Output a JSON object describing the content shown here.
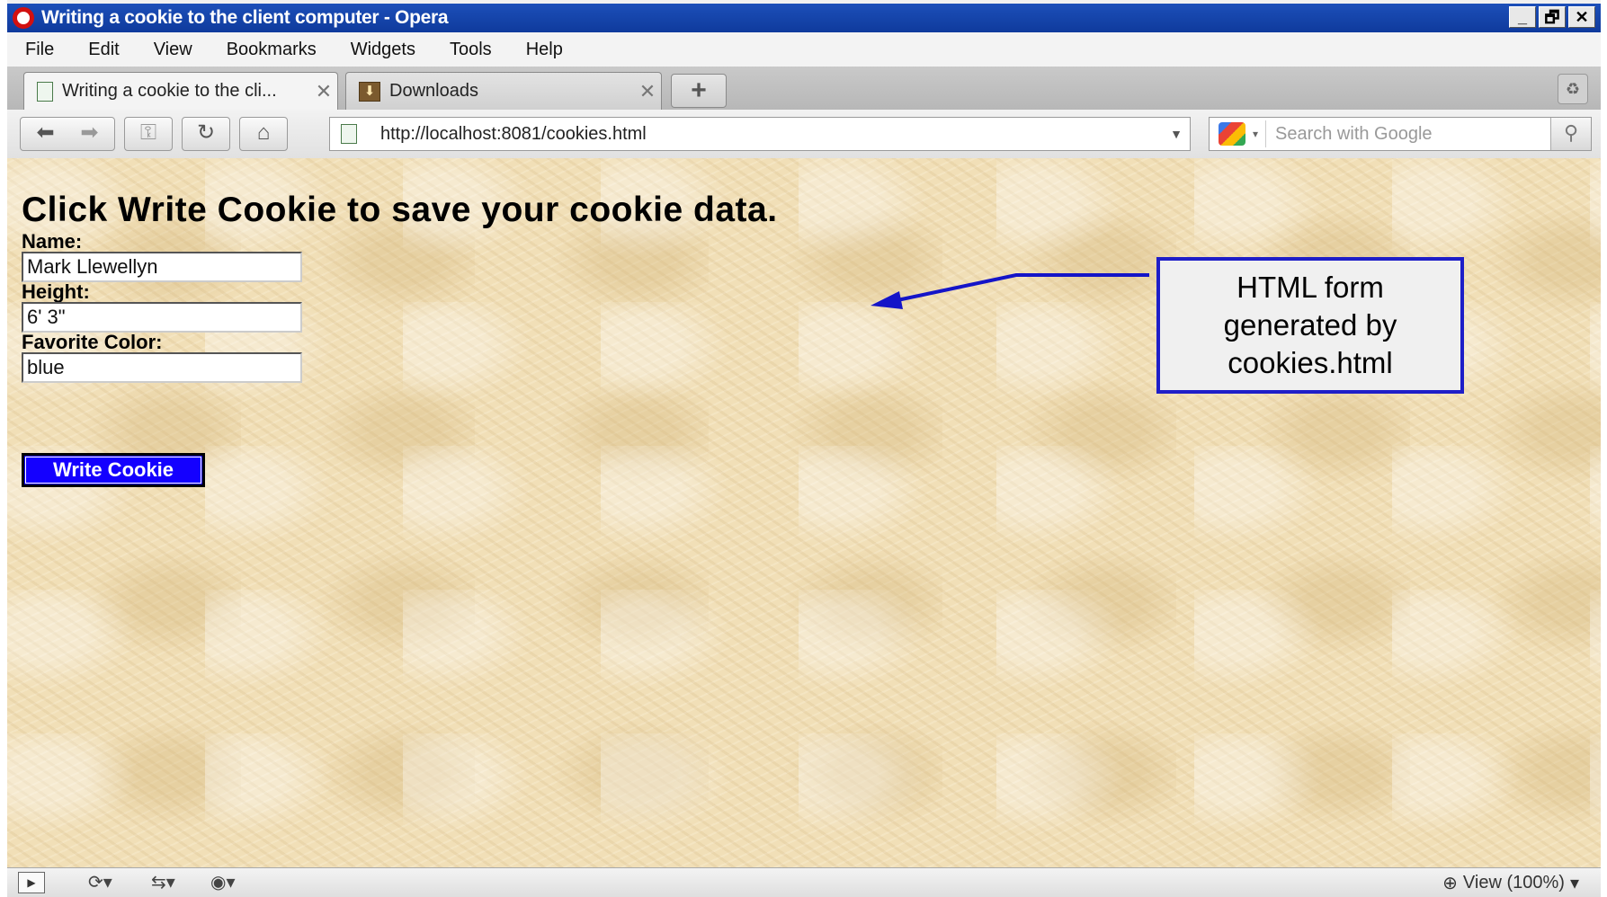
{
  "window": {
    "title": "Writing a cookie to the client computer - Opera",
    "controls": [
      "_",
      "🗗",
      "✕"
    ]
  },
  "menu": [
    "File",
    "Edit",
    "View",
    "Bookmarks",
    "Widgets",
    "Tools",
    "Help"
  ],
  "tabs": [
    {
      "label": "Writing a cookie to the cli...",
      "close": "✕"
    },
    {
      "label": "Downloads",
      "close": "✕"
    }
  ],
  "new_tab": "+",
  "nav": {
    "back": "⬅",
    "forward": "➡",
    "key": "⚿",
    "reload": "↻",
    "home": "⌂",
    "url": "http://localhost:8081/cookies.html",
    "url_dropdown": "▼"
  },
  "search": {
    "placeholder": "Search with Google",
    "engine_dropdown": "▾",
    "go": "⚲"
  },
  "page": {
    "heading": "Click Write Cookie to save your cookie data.",
    "name_label": "Name:",
    "name_value": "Mark Llewellyn",
    "height_label": "Height:",
    "height_value": "6' 3\"",
    "color_label": "Favorite Color:",
    "color_value": "blue",
    "button": "Write Cookie"
  },
  "annotation": {
    "text": "HTML form\ngenerated by\ncookies.html",
    "border_color": "#1e1ec8",
    "arrow_color": "#1414c8"
  },
  "status": {
    "panel": "▶",
    "sync": "⟳▾",
    "unite": "⇆▾",
    "turbo": "◉▾",
    "zoom_icon": "⊕",
    "zoom_label": "View (100%)",
    "zoom_dropdown": "▾"
  },
  "colors": {
    "titlebar": "#1c4fb9",
    "button_bg": "#1400ff",
    "page_bg": "#f1dfb7"
  }
}
